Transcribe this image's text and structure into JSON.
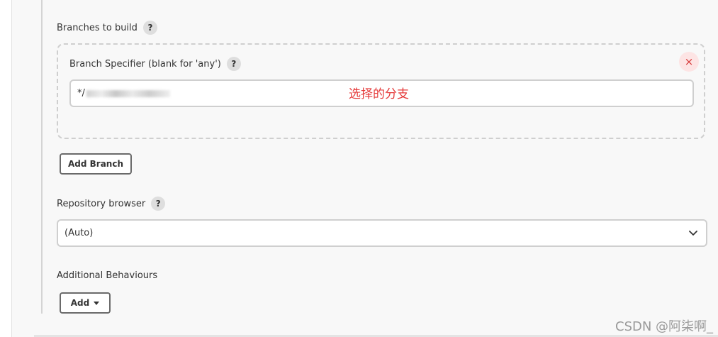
{
  "branches": {
    "label": "Branches to build",
    "help": "?",
    "specifier_label": "Branch Specifier (blank for 'any')",
    "specifier_help": "?",
    "specifier_value_prefix": "*/",
    "close_glyph": "×",
    "annotation": "选择的分支",
    "add_branch_label": "Add Branch"
  },
  "repository_browser": {
    "label": "Repository browser",
    "help": "?",
    "selected": "(Auto)"
  },
  "additional_behaviours": {
    "label": "Additional Behaviours",
    "add_label": "Add"
  },
  "watermark": "CSDN @阿柒啊_",
  "colors": {
    "annotation": "#e53a3a",
    "close_bg": "#fde4e4",
    "close_fg": "#d63a3a"
  }
}
